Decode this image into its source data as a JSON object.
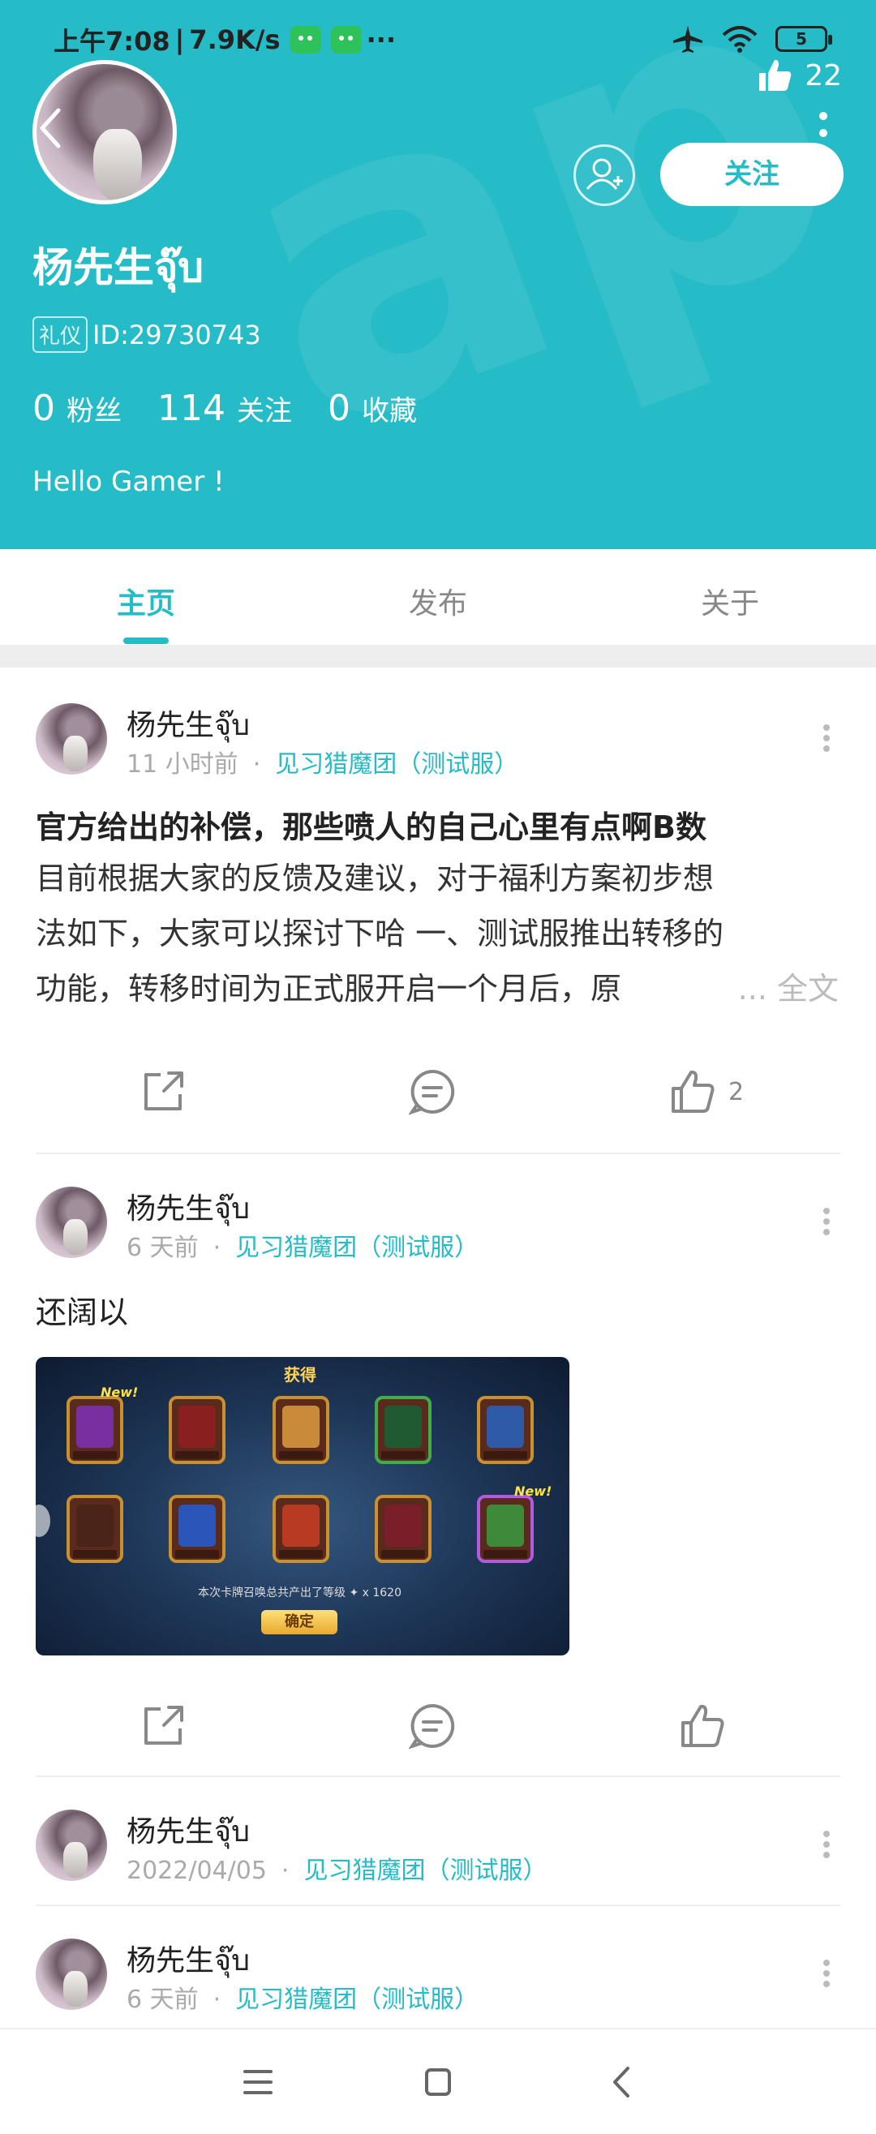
{
  "status_bar": {
    "time": "上午7:08",
    "speed": "7.9K/s",
    "battery": "5",
    "extra": "···"
  },
  "header": {
    "like_count": "22",
    "follow_label": "关注",
    "username": "杨先生จุ๊บ",
    "tag": "礼仪",
    "id_text": "ID:29730743",
    "stats": [
      {
        "num": "0",
        "label": "粉丝"
      },
      {
        "num": "114",
        "label": "关注"
      },
      {
        "num": "0",
        "label": "收藏"
      }
    ],
    "bio": "Hello Gamer !",
    "accent": "#26bcc7"
  },
  "tabs": [
    {
      "label": "主页",
      "active": true
    },
    {
      "label": "发布",
      "active": false
    },
    {
      "label": "关于",
      "active": false
    }
  ],
  "posts": [
    {
      "name": "杨先生จุ๊บ",
      "time": "11 小时前",
      "sep": "·",
      "circle": "见习猎魔团（测试服）",
      "title": "官方给出的补偿，那些喷人的自己心里有点啊B数",
      "body": "目前根据大家的反馈及建议，对于福利方案初步想法如下，大家可以探讨下哈 一、测试服推出转移的功能，转移时间为正式服开启一个月后，原",
      "more": "... 全文",
      "likes": "2"
    },
    {
      "name": "杨先生จุ๊บ",
      "time": "6 天前",
      "sep": "·",
      "circle": "见习猎魔团（测试服）",
      "text": "还阔以",
      "image": {
        "title": "获得",
        "caption": "本次卡牌召唤总共产出了等级  ✦ x 1620",
        "confirm": "确定",
        "new_badge": "New!"
      }
    },
    {
      "name": "杨先生จุ๊บ",
      "time": "2022/04/05",
      "sep": "·",
      "circle": "见习猎魔团（测试服）"
    },
    {
      "name": "杨先生จุ๊บ",
      "time": "6 天前",
      "sep": "·",
      "circle": "见习猎魔团（测试服）"
    }
  ]
}
